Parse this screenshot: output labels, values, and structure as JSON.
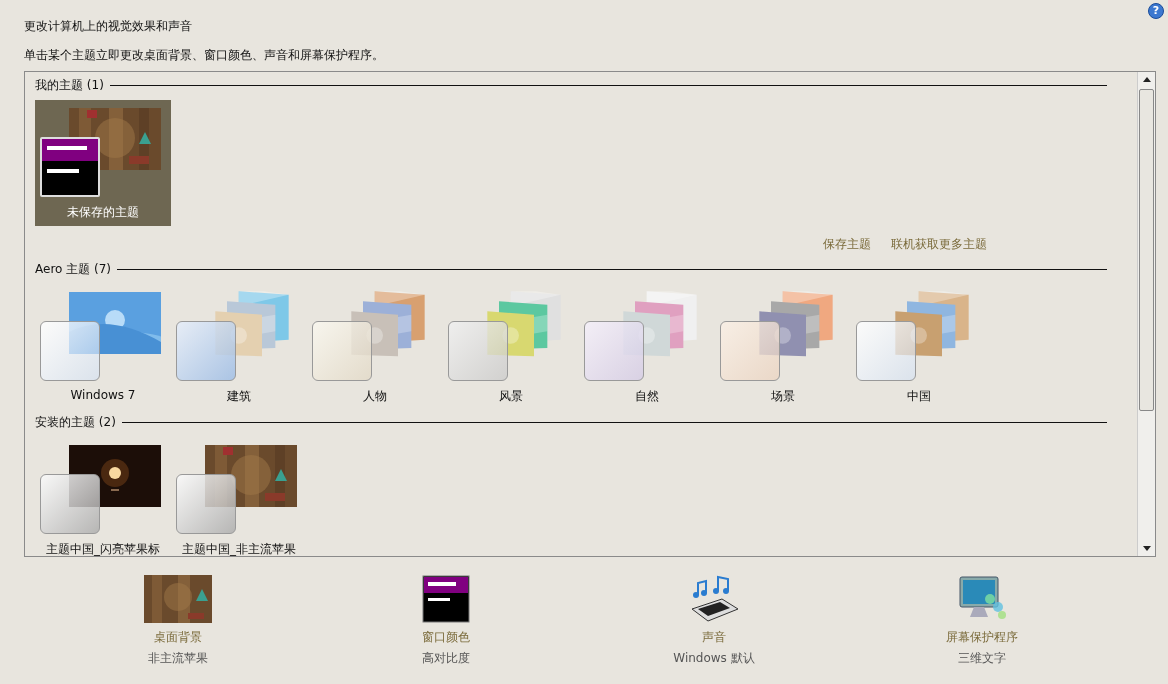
{
  "help_button": "?",
  "header": {
    "title": "更改计算机上的视觉效果和声音",
    "subtitle": "单击某个主题立即更改桌面背景、窗口颜色、声音和屏幕保护程序。"
  },
  "themes_panel": {
    "groups": [
      {
        "title": "我的主题 (1)",
        "themes": [
          {
            "name": "未保存的主题",
            "kind": "wood",
            "tile": {
              "kind": "contrast"
            },
            "selected": true
          }
        ],
        "links": [
          "保存主题",
          "联机获取更多主题"
        ]
      },
      {
        "title": "Aero 主题 (7)",
        "themes": [
          {
            "name": "Windows 7",
            "kind": "windows",
            "tile": {
              "kind": "glass"
            },
            "selected": false
          },
          {
            "name": "建筑",
            "kind": "stack",
            "tile": {
              "kind": "glass"
            },
            "selected": false
          },
          {
            "name": "人物",
            "kind": "stack",
            "tile": {
              "kind": "glass"
            },
            "selected": false
          },
          {
            "name": "风景",
            "kind": "stack",
            "tile": {
              "kind": "glass"
            },
            "selected": false
          },
          {
            "name": "自然",
            "kind": "stack",
            "tile": {
              "kind": "glass"
            },
            "selected": false
          },
          {
            "name": "场景",
            "kind": "stack",
            "tile": {
              "kind": "glass"
            },
            "selected": false
          },
          {
            "name": "中国",
            "kind": "stack",
            "tile": {
              "kind": "glass"
            },
            "selected": false
          }
        ]
      },
      {
        "title": "安装的主题 (2)",
        "themes": [
          {
            "name": "主题中国_闪亮苹果标",
            "kind": "dark",
            "tile": {
              "kind": "glass"
            },
            "selected": false
          },
          {
            "name": "主题中国_非主流苹果",
            "kind": "wood",
            "tile": {
              "kind": "glass"
            },
            "selected": false
          }
        ]
      }
    ]
  },
  "settings": [
    {
      "label": "桌面背景",
      "value": "非主流苹果",
      "kind": "wallpaper"
    },
    {
      "label": "窗口颜色",
      "value": "高对比度",
      "kind": "color"
    },
    {
      "label": "声音",
      "value": "Windows 默认",
      "kind": "sound"
    },
    {
      "label": "屏幕保护程序",
      "value": "三维文字",
      "kind": "screensaver"
    }
  ]
}
